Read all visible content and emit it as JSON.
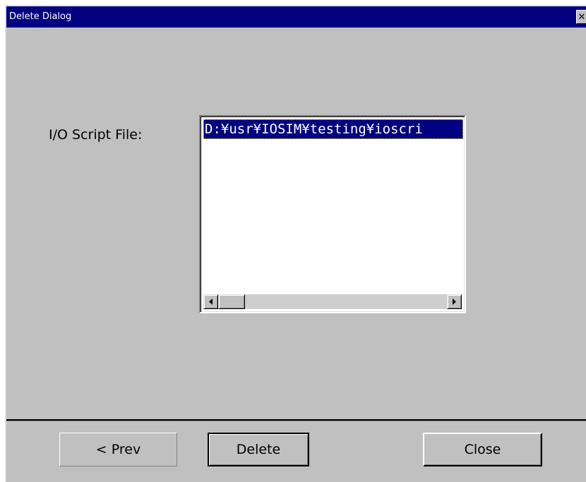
{
  "window": {
    "title": "Delete Dialog",
    "close_glyph": "✕"
  },
  "form": {
    "label": "I/O Script File:",
    "list_items": [
      "D:¥usr¥IOSIM¥testing¥ioscri"
    ],
    "selected_index": 0
  },
  "scrollbar": {
    "left_arrow": "◀",
    "right_arrow": "▶"
  },
  "buttons": {
    "prev_label": "< Prev",
    "delete_label": "Delete",
    "close_label": "Close"
  },
  "colors": {
    "face": "#c0c0c0",
    "titlebar": "#000080",
    "selection": "#000080"
  }
}
